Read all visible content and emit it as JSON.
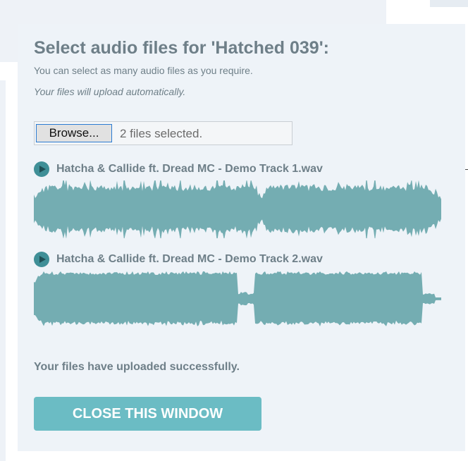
{
  "dialog": {
    "title": "Select audio files for 'Hatched 039':",
    "subtitle": "You can select as many audio files as you require.",
    "note": "Your files will upload automatically.",
    "file_input": {
      "browse_label": "Browse...",
      "status": "2 files selected."
    },
    "tracks": [
      {
        "name": "Hatcha & Callide ft. Dread MC - Demo Track 1.wav",
        "icon": "play-icon"
      },
      {
        "name": "Hatcha & Callide ft. Dread MC - Demo Track 2.wav",
        "icon": "play-icon"
      }
    ],
    "success_message": "Your files have uploaded successfully.",
    "close_button_label": "CLOSE THIS WINDOW"
  },
  "colors": {
    "accent": "#6bbcc4",
    "waveform": "#74adb2",
    "play_icon": "#3f8f97",
    "text": "#6e7f88",
    "dialog_background": "#eef3f8"
  }
}
